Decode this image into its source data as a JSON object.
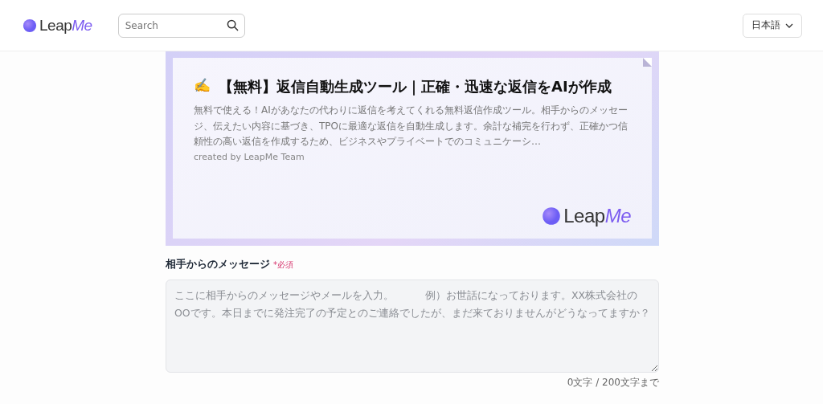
{
  "header": {
    "logo": {
      "main": "Leap",
      "accent": "Me"
    },
    "search": {
      "placeholder": "Search"
    },
    "language": {
      "label": "日本語"
    }
  },
  "banner": {
    "emoji": "✍️",
    "title": "【無料】返信自動生成ツール｜正確・迅速な返信をAIが作成",
    "description": "無料で使える！AIがあなたの代わりに返信を考えてくれる無料返信作成ツール。相手からのメッセージ、伝えたい内容に基づき、TPOに最適な返信を自動生成します。余計な補完を行わず、正確かつ信頼性の高い返信を作成するため、ビジネスやプライベートでのコミュニケーシ…",
    "credit": "created by LeapMe Team",
    "logo": {
      "main": "Leap",
      "accent": "Me"
    }
  },
  "form": {
    "fields": [
      {
        "kind": "textarea",
        "label": "相手からのメッセージ",
        "required_mark": "*必須",
        "placeholder": "ここに相手からのメッセージやメールを入力。　　　例）お世話になっております。XX株式会社のOOです。本日までに発注完了の予定とのご連絡でしたが、まだ来ておりませんがどうなってますか？",
        "counter": "0文字 / 200文字まで"
      }
    ]
  }
}
